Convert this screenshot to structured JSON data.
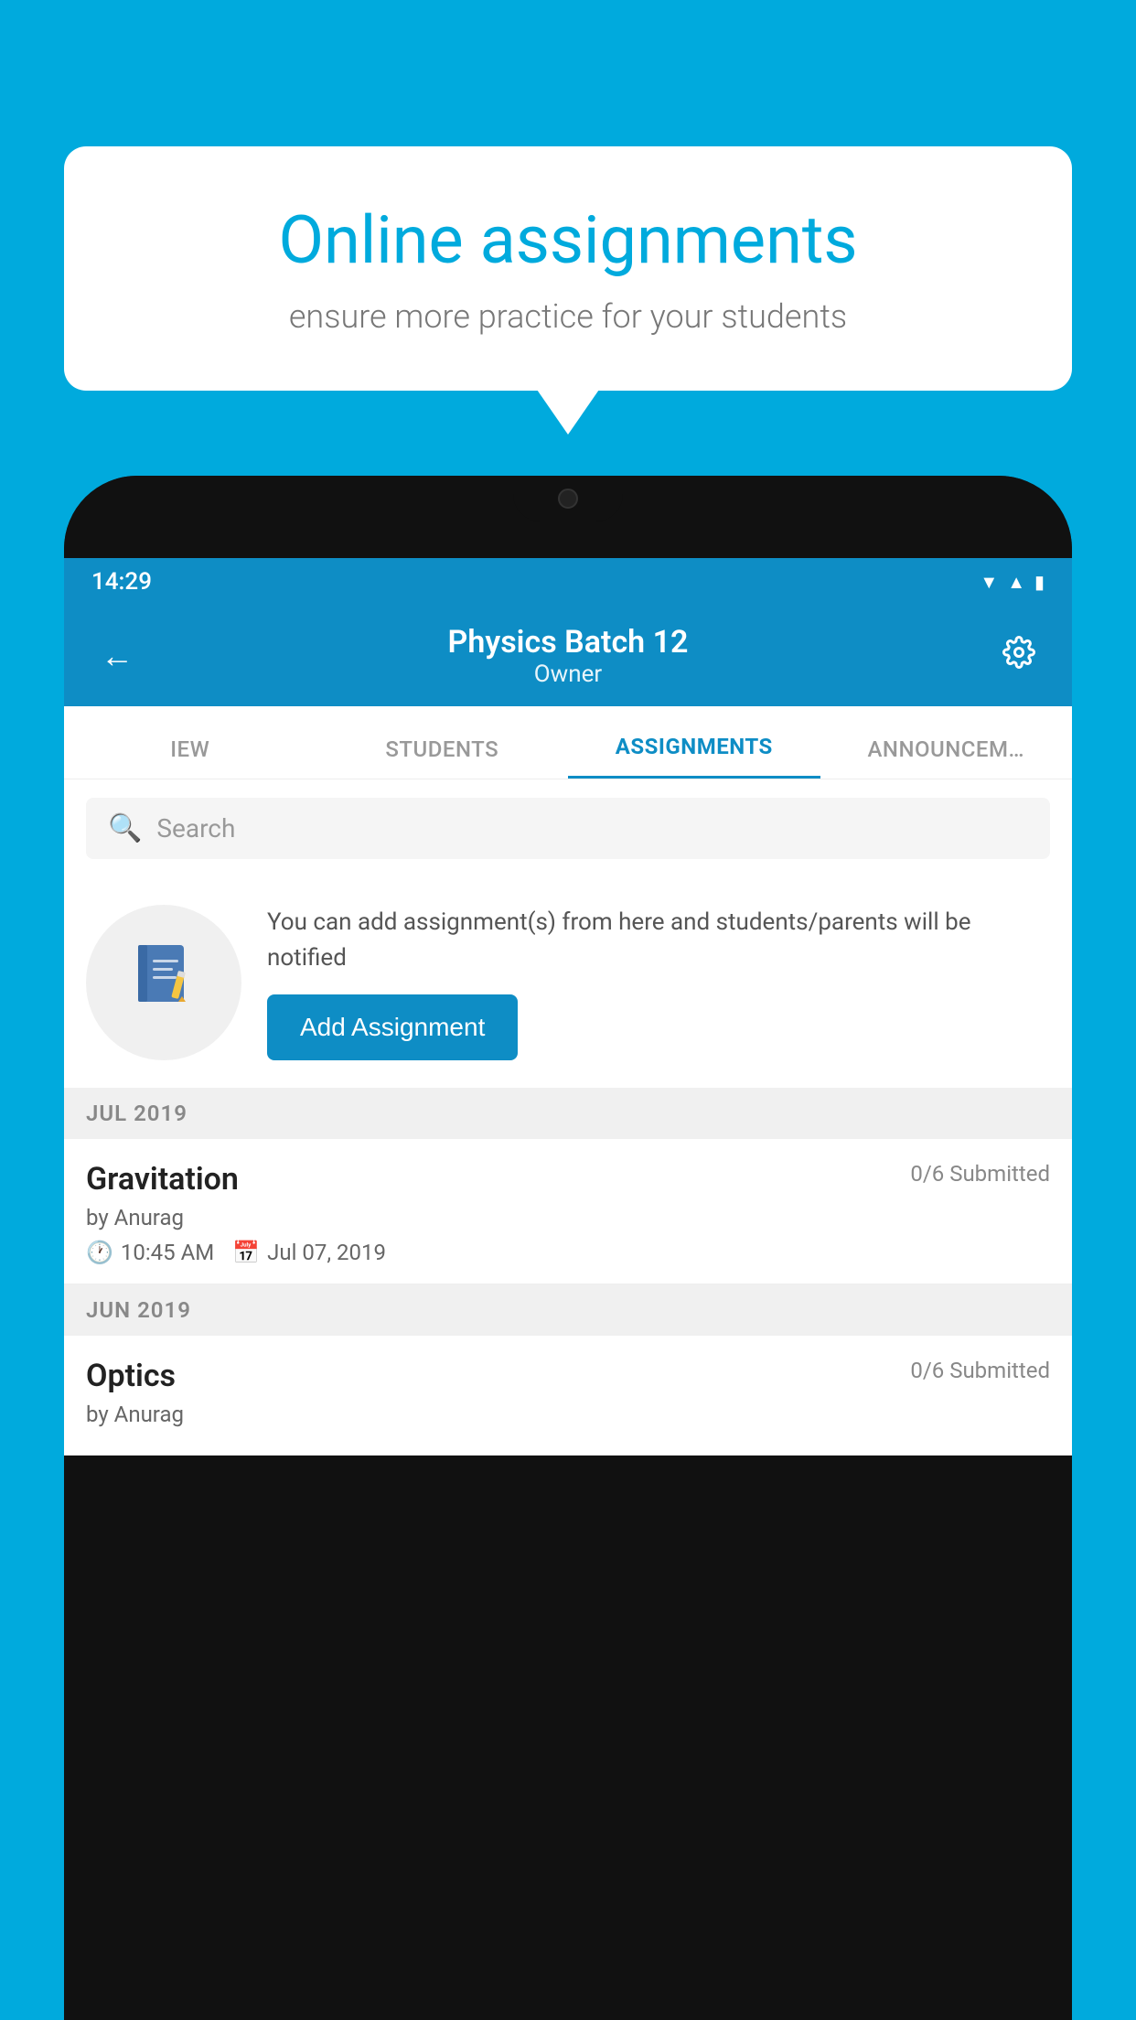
{
  "background": {
    "color": "#00AADD"
  },
  "speech_bubble": {
    "title": "Online assignments",
    "subtitle": "ensure more practice for your students"
  },
  "phone": {
    "status_bar": {
      "time": "14:29",
      "icons": [
        "wifi",
        "signal",
        "battery"
      ]
    },
    "header": {
      "title": "Physics Batch 12",
      "subtitle": "Owner",
      "back_label": "←",
      "settings_label": "⚙"
    },
    "tabs": [
      {
        "label": "IEW",
        "active": false
      },
      {
        "label": "STUDENTS",
        "active": false
      },
      {
        "label": "ASSIGNMENTS",
        "active": true
      },
      {
        "label": "ANNOUNCEM...",
        "active": false
      }
    ],
    "search": {
      "placeholder": "Search"
    },
    "promo": {
      "text": "You can add assignment(s) from here and students/parents will be notified",
      "button_label": "Add Assignment"
    },
    "sections": [
      {
        "label": "JUL 2019",
        "assignments": [
          {
            "title": "Gravitation",
            "submitted": "0/6 Submitted",
            "author": "by Anurag",
            "time": "10:45 AM",
            "date": "Jul 07, 2019"
          }
        ]
      },
      {
        "label": "JUN 2019",
        "assignments": [
          {
            "title": "Optics",
            "submitted": "0/6 Submitted",
            "author": "by Anurag",
            "time": "",
            "date": ""
          }
        ]
      }
    ]
  }
}
